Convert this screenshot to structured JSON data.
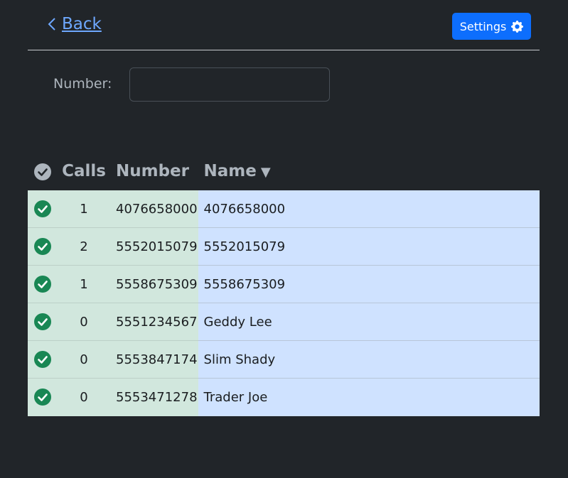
{
  "header": {
    "back_label": "Back",
    "settings_label": "Settings"
  },
  "filter": {
    "number_label": "Number:",
    "number_value": ""
  },
  "table": {
    "columns": {
      "calls": "Calls",
      "number": "Number",
      "name": "Name",
      "sort_indicator": "▼"
    },
    "rows": [
      {
        "calls": "1",
        "number": "4076658000",
        "name": "4076658000"
      },
      {
        "calls": "2",
        "number": "5552015079",
        "name": "5552015079"
      },
      {
        "calls": "1",
        "number": "5558675309",
        "name": "5558675309"
      },
      {
        "calls": "0",
        "number": "5551234567",
        "name": "Geddy Lee"
      },
      {
        "calls": "0",
        "number": "5553847174",
        "name": "Slim Shady"
      },
      {
        "calls": "0",
        "number": "5553471278",
        "name": "Trader Joe"
      }
    ]
  },
  "colors": {
    "background": "#212529",
    "link": "#6ea8fe",
    "primary": "#0d6efd",
    "row_left_bg": "#d1e7dd",
    "row_right_bg": "#cfe2ff",
    "check_green": "#198754",
    "header_check_gray": "#adb5bd"
  },
  "icons": {
    "back": "chevron-left-icon",
    "settings": "gear-icon",
    "row_check": "check-circle-icon",
    "header_check": "check-circle-icon"
  }
}
